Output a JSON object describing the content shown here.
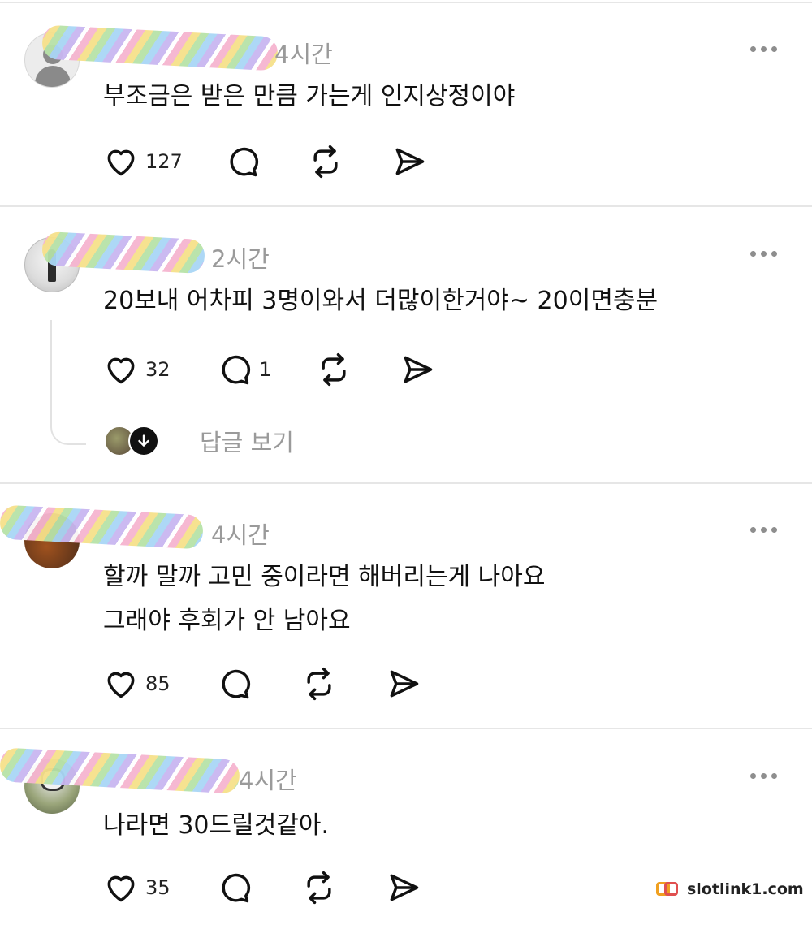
{
  "posts": [
    {
      "time": "4시간",
      "text_lines": [
        "부조금은 받은 만큼 가는게 인지상정이야"
      ],
      "likes": "127",
      "comments": ""
    },
    {
      "time": "2시간",
      "text_lines": [
        "20보내 어차피 3명이와서 더많이한거야~  20이면충분"
      ],
      "likes": "32",
      "comments": "1",
      "reply_link": "답글 보기"
    },
    {
      "time": "4시간",
      "text_lines": [
        "할까 말까 고민 중이라면 해버리는게 나아요",
        "그래야 후회가 안 남아요"
      ],
      "likes": "85",
      "comments": ""
    },
    {
      "time": "4시간",
      "text_lines": [
        "나라면 30드릴것같아."
      ],
      "likes": "35",
      "comments": ""
    }
  ],
  "watermark": {
    "text": "slotlink1.com"
  },
  "icons": [
    "heart-icon",
    "comment-icon",
    "repost-icon",
    "share-icon",
    "more-icon",
    "arrow-down-icon"
  ]
}
